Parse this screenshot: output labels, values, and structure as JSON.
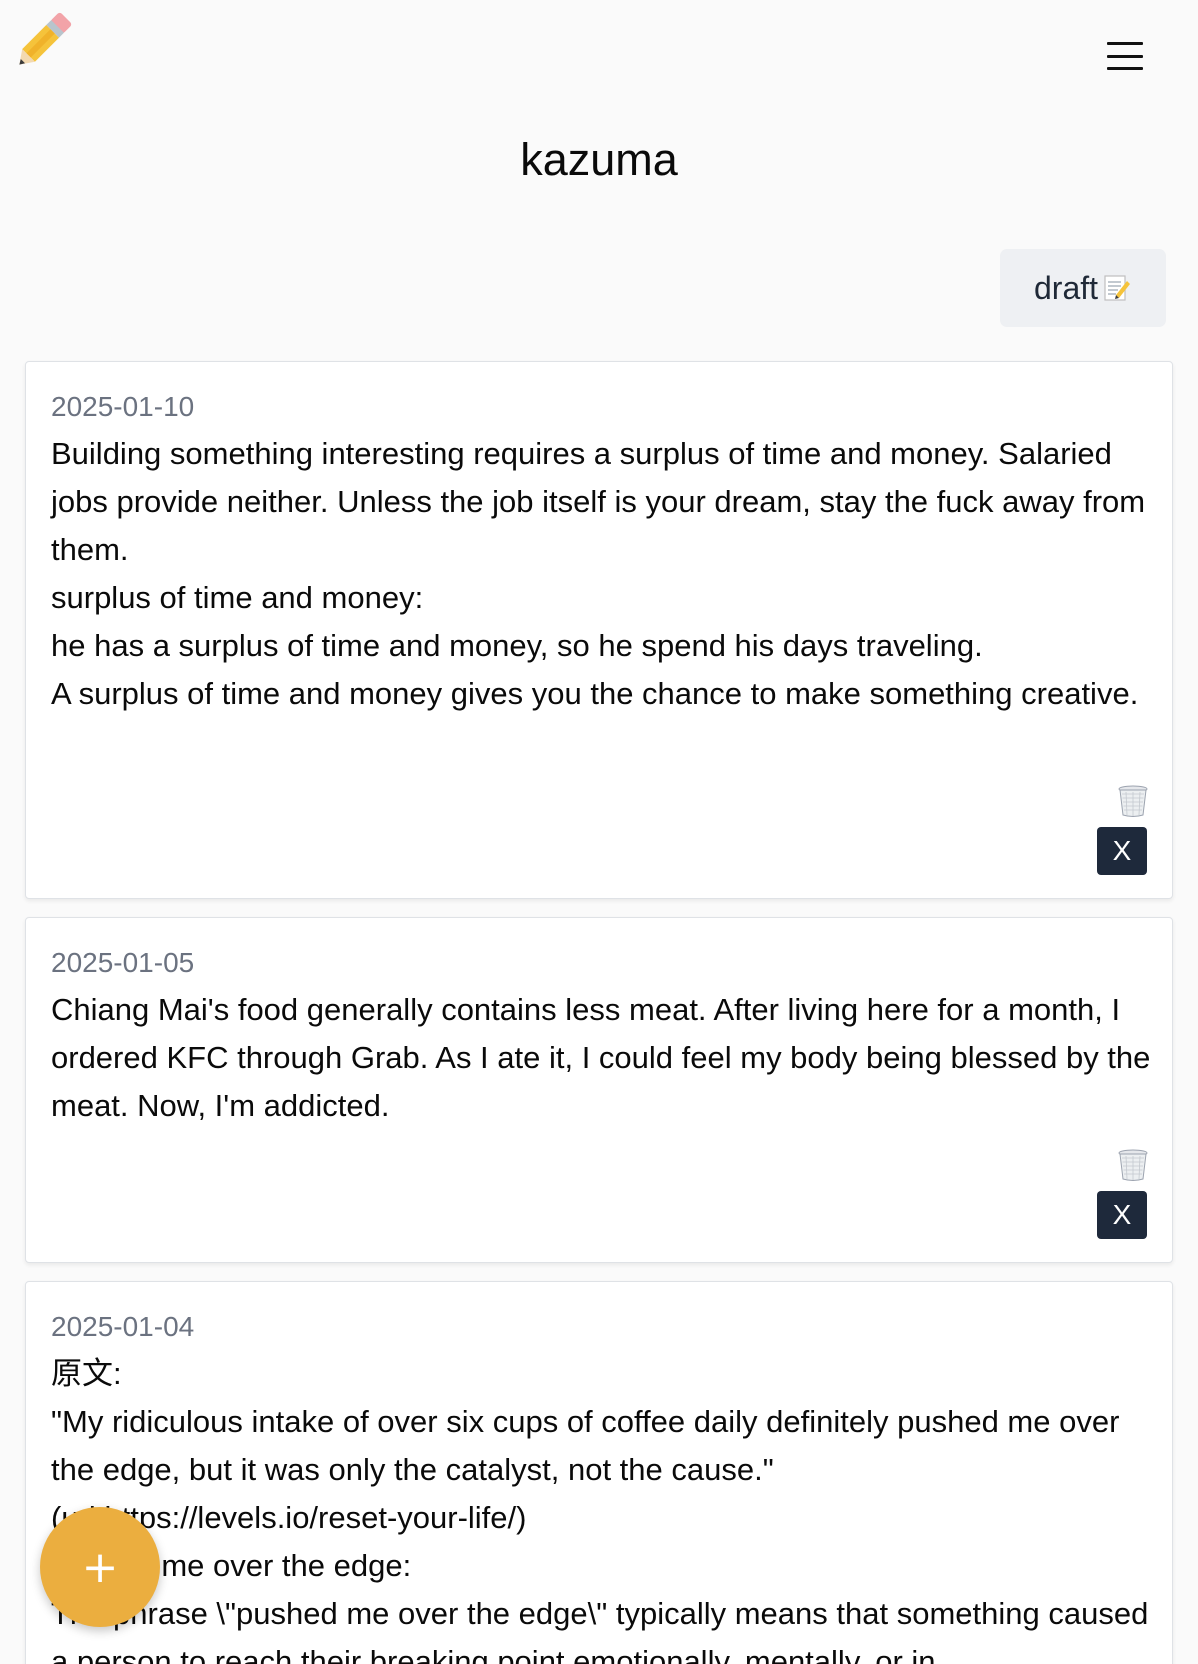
{
  "header": {
    "logo_icon": "pencil-icon",
    "menu_icon": "hamburger-menu-icon"
  },
  "page_title": "kazuma",
  "draft_button": {
    "label": "draft",
    "icon": "memo-icon"
  },
  "posts": [
    {
      "date": "2025-01-10",
      "lines": [
        "Building something interesting requires a surplus of time and money. Salaried jobs provide neither. Unless the job itself is your dream, stay the fuck away from them.",
        "surplus of time and money:",
        "he has a surplus of time and money, so he spend his days traveling.",
        "A surplus of time and money gives you the chance to make something creative."
      ],
      "delete_icon": "trash-can-icon",
      "close_label": "X"
    },
    {
      "date": "2025-01-05",
      "lines": [
        "Chiang Mai's food generally contains less meat. After living here for a month, I ordered KFC through Grab. As I ate it, I could feel my body being blessed by the meat. Now, I'm addicted."
      ],
      "delete_icon": "trash-can-icon",
      "close_label": "X"
    },
    {
      "date": "2025-01-04",
      "lines": [
        "原文:",
        "\"My ridiculous intake of over six cups of coffee daily definitely pushed me over the edge, but it was only the catalyst, not the cause.\"",
        "(url:https://levels.io/reset-your-life/)",
        "pushed me over the edge:",
        "The phrase \\\"pushed me over the edge\\\" typically means that something caused a person to reach their breaking point emotionally, mentally, or in"
      ]
    }
  ],
  "fab": {
    "label": "+"
  },
  "colors": {
    "fab": "#ebae3f",
    "close_button": "#1e293b",
    "draft_button_bg": "#eef0f3",
    "date_text": "#6b7280"
  }
}
